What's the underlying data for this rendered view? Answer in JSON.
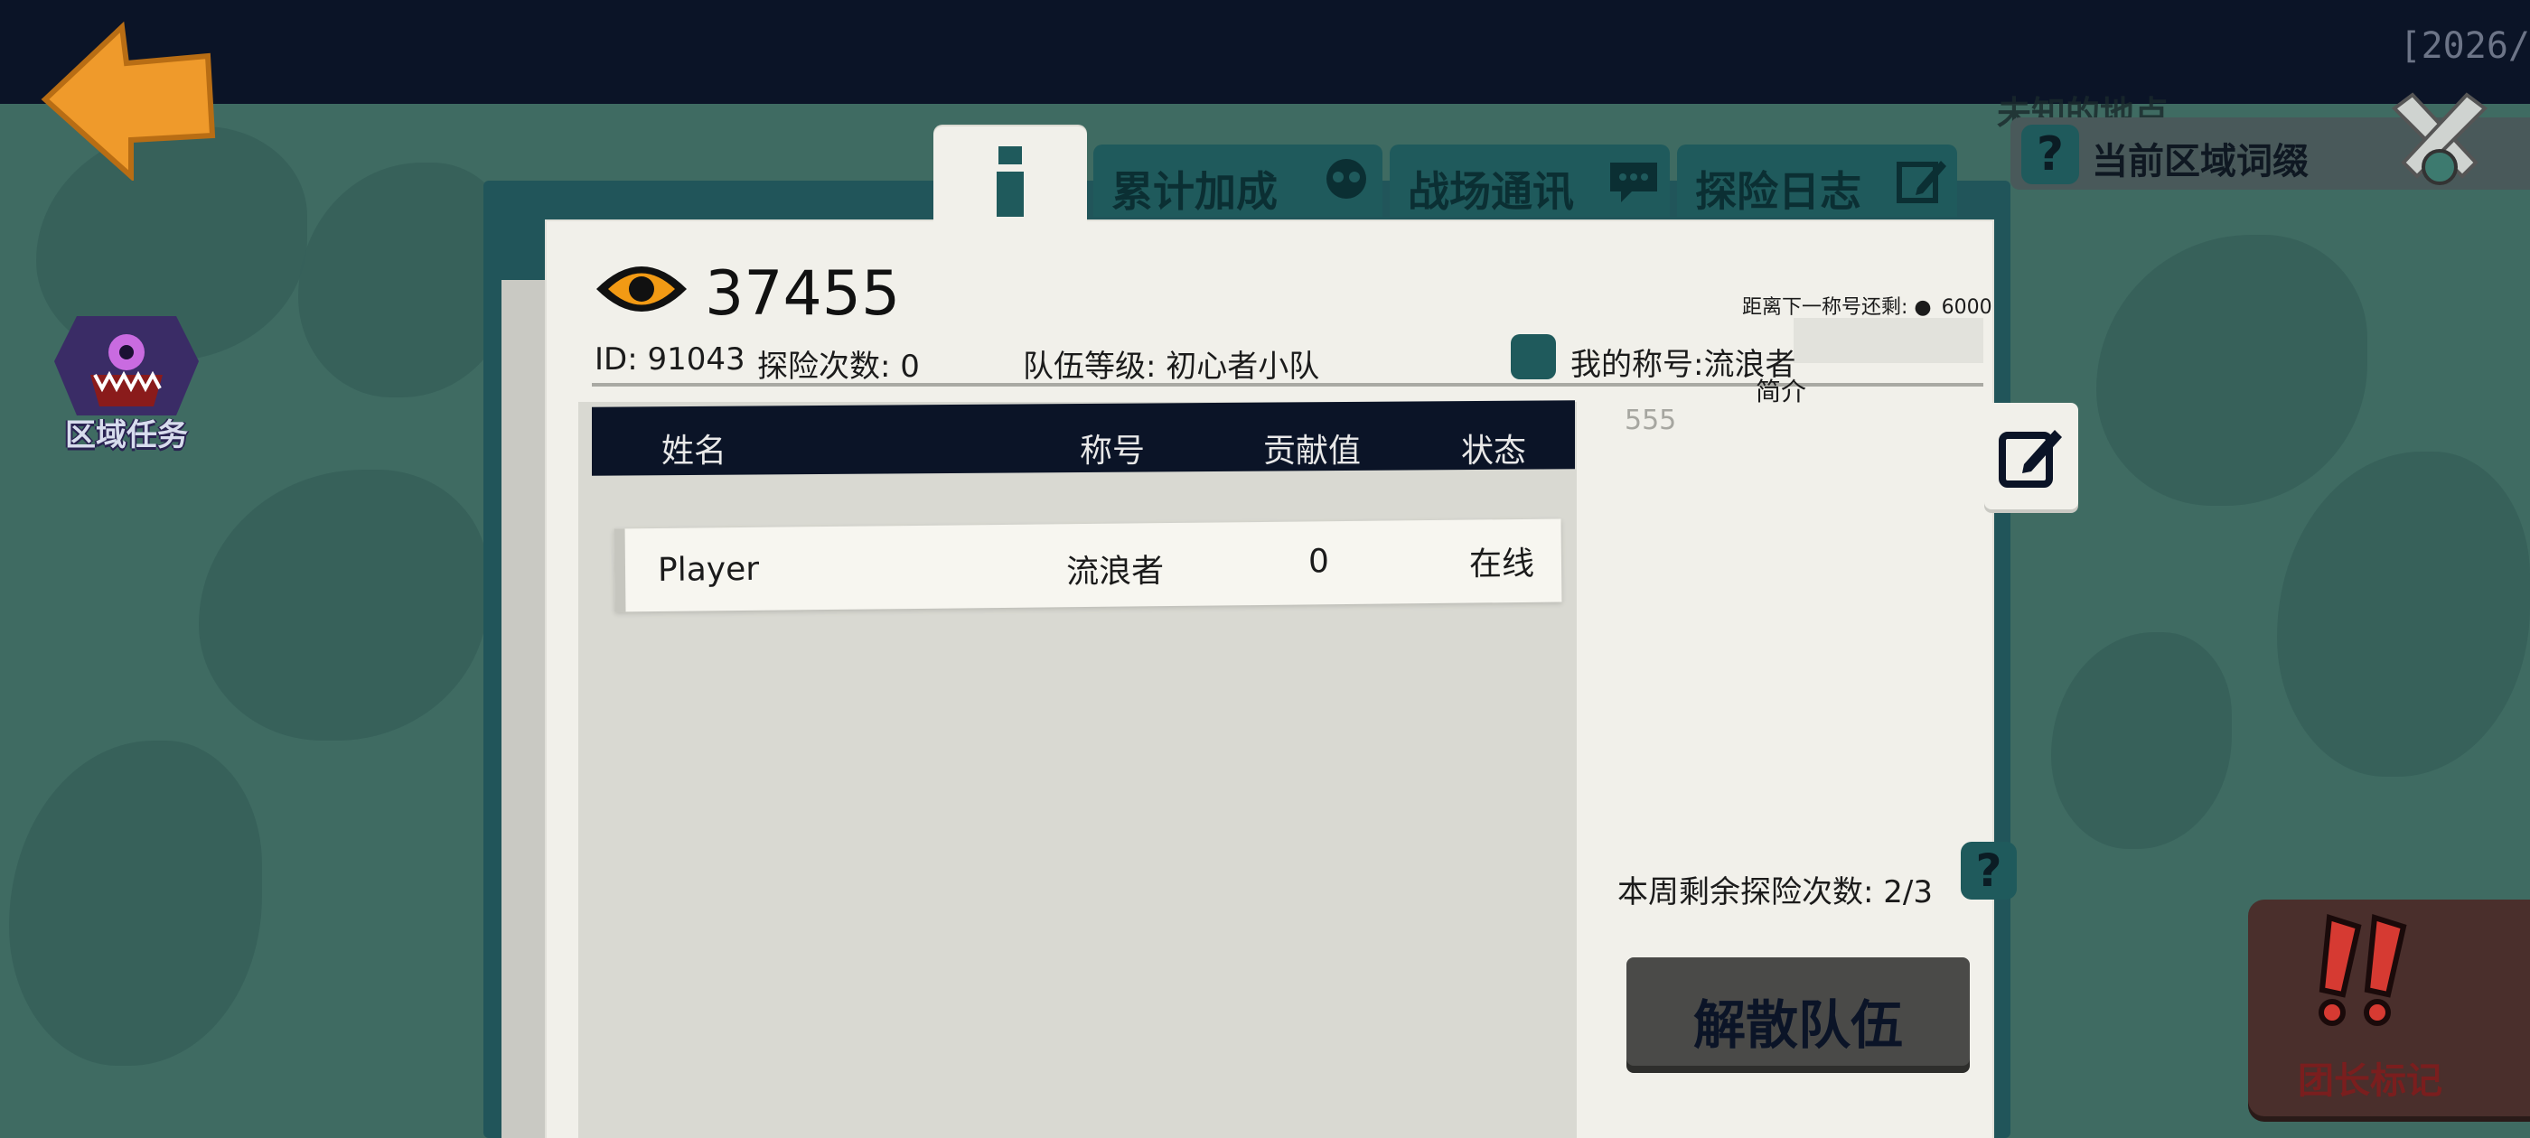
{
  "topbar": {
    "stamp": "[2026/"
  },
  "side": {
    "task_label": "区域任务"
  },
  "region": {
    "partial_label": "未知的地点",
    "suffix_label": "当前区域词缀",
    "help": "?"
  },
  "leader": {
    "label": "团长标记"
  },
  "tabs": [
    {
      "label": "累计加成",
      "icon": "skull-icon"
    },
    {
      "label": "战场通讯",
      "icon": "chat-icon"
    },
    {
      "label": "探险日志",
      "icon": "edit-icon"
    }
  ],
  "team": {
    "score": "37455",
    "id_text": "ID: 91043",
    "explore_count_text": "探险次数: 0",
    "level_text": "队伍等级: 初心者小队",
    "next_title_text": "距离下一称号还剩:",
    "next_title_value": "6000",
    "my_title_text": "我的称号:流浪者",
    "intro_label": "简介",
    "intro_text": "555",
    "weekly_text": "本周剩余探险次数:  2/3",
    "disband_label": "解散队伍"
  },
  "table": {
    "headers": [
      "姓名",
      "称号",
      "贡献值",
      "状态"
    ],
    "rows": [
      {
        "name": "Player",
        "title": "流浪者",
        "contribution": "0",
        "status": "在线"
      }
    ]
  },
  "colors": {
    "accent": "#1f5a5c",
    "eye": "#f29a14",
    "back_arrow": "#ef9a2b",
    "leader_mark": "#d63a32"
  }
}
